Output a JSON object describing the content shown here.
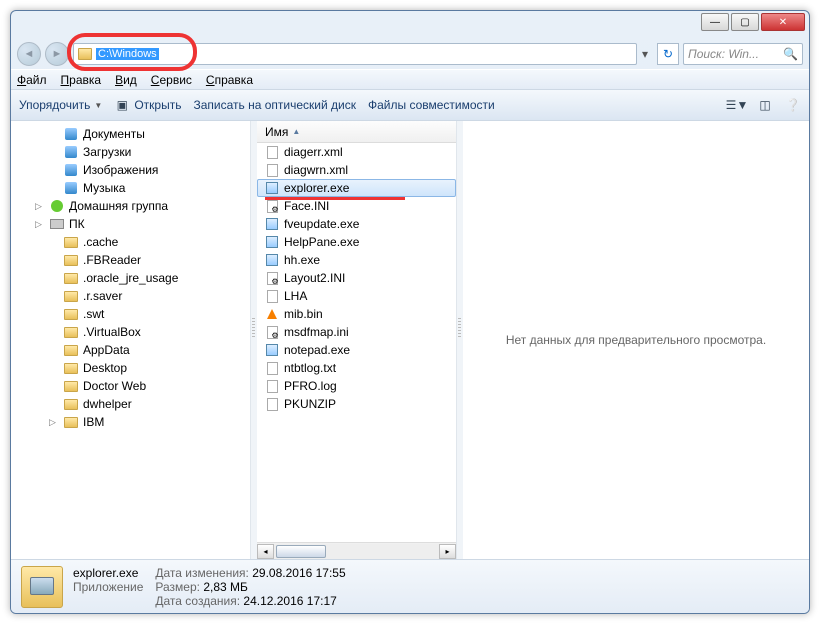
{
  "titlebar": {
    "min": "—",
    "max": "▢",
    "close": "✕"
  },
  "nav": {
    "back": "◄",
    "fwd": "►"
  },
  "address": {
    "path": "C:\\Windows",
    "drop": "▾",
    "refresh": "↻"
  },
  "search": {
    "placeholder": "Поиск: Win...",
    "icon": "🔍"
  },
  "menubar": [
    "Файл",
    "Правка",
    "Вид",
    "Сервис",
    "Справка"
  ],
  "toolbar": {
    "organize": "Упорядочить",
    "open": "Открыть",
    "burn": "Записать на оптический диск",
    "compat": "Файлы совместимости"
  },
  "tree": [
    {
      "lvl": 1,
      "ico": "lib",
      "label": "Документы"
    },
    {
      "lvl": 1,
      "ico": "lib",
      "label": "Загрузки"
    },
    {
      "lvl": 1,
      "ico": "lib",
      "label": "Изображения"
    },
    {
      "lvl": 1,
      "ico": "lib",
      "label": "Музыка"
    },
    {
      "lvl": 0,
      "ico": "hg",
      "arrow": "▷",
      "label": "Домашняя группа"
    },
    {
      "lvl": 0,
      "ico": "pc",
      "arrow": "▷",
      "label": "ПК"
    },
    {
      "lvl": 1,
      "ico": "folder",
      "label": ".cache"
    },
    {
      "lvl": 1,
      "ico": "folder",
      "label": ".FBReader"
    },
    {
      "lvl": 1,
      "ico": "folder",
      "label": ".oracle_jre_usage"
    },
    {
      "lvl": 1,
      "ico": "folder",
      "label": ".r.saver"
    },
    {
      "lvl": 1,
      "ico": "folder",
      "label": ".swt"
    },
    {
      "lvl": 1,
      "ico": "folder",
      "label": ".VirtualBox"
    },
    {
      "lvl": 1,
      "ico": "folder",
      "label": "AppData"
    },
    {
      "lvl": 1,
      "ico": "folder",
      "label": "Desktop"
    },
    {
      "lvl": 1,
      "ico": "folder",
      "label": "Doctor Web"
    },
    {
      "lvl": 1,
      "ico": "folder",
      "label": "dwhelper"
    },
    {
      "lvl": 1,
      "ico": "folder",
      "arrow": "▷",
      "label": "IBM"
    }
  ],
  "filelist": {
    "header": "Имя",
    "items": [
      {
        "ico": "file",
        "name": "diagerr.xml"
      },
      {
        "ico": "file",
        "name": "diagwrn.xml"
      },
      {
        "ico": "exe",
        "name": "explorer.exe",
        "sel": true
      },
      {
        "ico": "ini",
        "name": "Face.INI"
      },
      {
        "ico": "exe",
        "name": "fveupdate.exe"
      },
      {
        "ico": "exe",
        "name": "HelpPane.exe"
      },
      {
        "ico": "exe",
        "name": "hh.exe"
      },
      {
        "ico": "ini",
        "name": "Layout2.INI"
      },
      {
        "ico": "file",
        "name": "LHA"
      },
      {
        "ico": "vlc",
        "name": "mib.bin"
      },
      {
        "ico": "ini",
        "name": "msdfmap.ini"
      },
      {
        "ico": "exe",
        "name": "notepad.exe"
      },
      {
        "ico": "file",
        "name": "ntbtlog.txt"
      },
      {
        "ico": "file",
        "name": "PFRO.log"
      },
      {
        "ico": "file",
        "name": "PKUNZIP"
      }
    ]
  },
  "preview": {
    "empty": "Нет данных для предварительного просмотра."
  },
  "details": {
    "name": "explorer.exe",
    "type": "Приложение",
    "mod_lbl": "Дата изменения:",
    "mod_val": "29.08.2016 17:55",
    "size_lbl": "Размер:",
    "size_val": "2,83 МБ",
    "created_lbl": "Дата создания:",
    "created_val": "24.12.2016 17:17"
  }
}
